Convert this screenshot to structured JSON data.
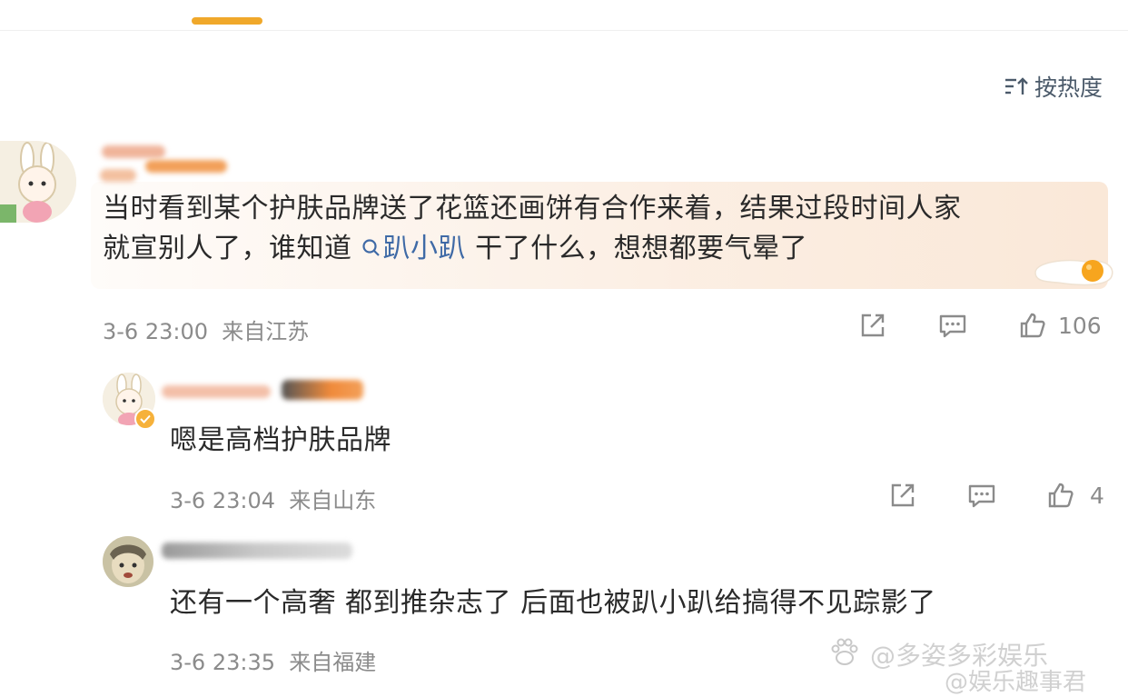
{
  "sort": {
    "label": "按热度",
    "icon": "sort-icon"
  },
  "comments": [
    {
      "text_before": "当时看到某个护肤品牌送了花篮还画饼有合作来着，结果过段时间人家",
      "line2_before": "就宣别人了，谁知道 ",
      "topic": "趴小趴",
      "line2_after": " 干了什么，想想都要气晕了",
      "time": "3-6 23:00",
      "location": "来自江苏",
      "likes": "106"
    },
    {
      "text": "嗯是高档护肤品牌",
      "time": "3-6 23:04",
      "location": "来自山东",
      "likes": "4"
    },
    {
      "text": "还有一个高奢 都到推杂志了 后面也被趴小趴给搞得不见踪影了",
      "time": "3-6 23:35",
      "location": "来自福建"
    }
  ],
  "watermark": {
    "line1": "多姿多彩娱乐",
    "line2": "@娱乐趣事君"
  },
  "colors": {
    "accent": "#f0a82a",
    "topic": "#3f6aa6",
    "meta": "#8b8b8b"
  }
}
